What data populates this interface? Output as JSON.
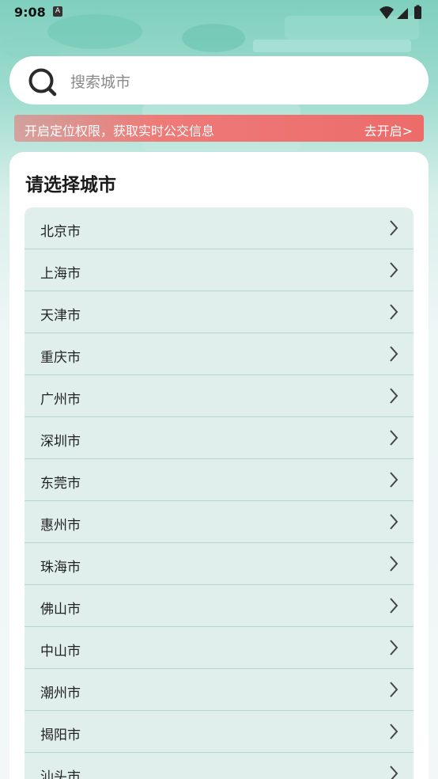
{
  "status_bar": {
    "time": "9:08",
    "notification_icon": "a-box-icon",
    "icons": [
      "wifi-icon",
      "cellular-icon",
      "battery-icon"
    ]
  },
  "search": {
    "placeholder": "搜索城市",
    "icon": "search-icon"
  },
  "location_banner": {
    "text": "开启定位权限，获取实时公交信息",
    "action": "去开启>",
    "color": "#ec6c6a"
  },
  "city_card": {
    "title": "请选择城市",
    "cities": [
      "北京市",
      "上海市",
      "天津市",
      "重庆市",
      "广州市",
      "深圳市",
      "东莞市",
      "惠州市",
      "珠海市",
      "佛山市",
      "中山市",
      "潮州市",
      "揭阳市",
      "汕头市"
    ]
  },
  "colors": {
    "accent_green": "#7fcfbe",
    "list_background": "#e0eeec",
    "row_divider": "#b6d7d0"
  }
}
